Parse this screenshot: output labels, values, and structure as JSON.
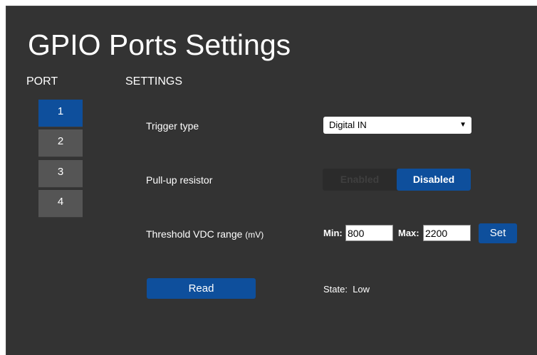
{
  "page_title": "GPIO Ports Settings",
  "port_header": "PORT",
  "settings_header": "SETTINGS",
  "ports": [
    {
      "label": "1",
      "active": true
    },
    {
      "label": "2",
      "active": false
    },
    {
      "label": "3",
      "active": false
    },
    {
      "label": "4",
      "active": false
    }
  ],
  "trigger": {
    "label": "Trigger type",
    "selected": "Digital IN",
    "arrow_icon": "triangle-down-icon"
  },
  "pullup": {
    "label": "Pull-up resistor",
    "enabled_label": "Enabled",
    "disabled_label": "Disabled",
    "selected": "Disabled"
  },
  "threshold": {
    "label": "Threshold VDC range",
    "unit": "(mV)",
    "min_label": "Min:",
    "min_value": "800",
    "max_label": "Max:",
    "max_value": "2200",
    "set_label": "Set"
  },
  "read": {
    "button_label": "Read",
    "state_label": "State:",
    "state_value": "Low"
  },
  "colors": {
    "panel_bg": "#333333",
    "accent_blue": "#0e4f9c",
    "port_inactive": "#555555"
  }
}
